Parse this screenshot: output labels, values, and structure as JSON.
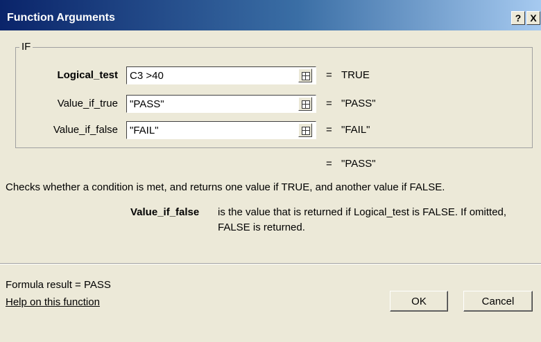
{
  "window": {
    "title": "Function Arguments",
    "help_glyph": "?",
    "close_glyph": "X"
  },
  "group": {
    "label": "IF"
  },
  "args": [
    {
      "label": "Logical_test",
      "value": "C3 >40",
      "equals": "=",
      "result": "TRUE"
    },
    {
      "label": "Value_if_true",
      "value": "\"PASS\"",
      "equals": "=",
      "result": "\"PASS\""
    },
    {
      "label": "Value_if_false",
      "value": "\"FAIL\"",
      "equals": "=",
      "result": "\"FAIL\""
    }
  ],
  "overall": {
    "equals": "=",
    "result": "\"PASS\""
  },
  "description": "Checks whether a condition is met, and returns one value if TRUE, and another value if FALSE.",
  "arg_help": {
    "name": "Value_if_false",
    "line1": "is the value that is returned if Logical_test is FALSE. If omitted,",
    "line2": "FALSE is returned."
  },
  "formula_result": "Formula result =   PASS",
  "help_link": "Help on this function",
  "buttons": {
    "ok": "OK",
    "cancel": "Cancel"
  },
  "icons": {
    "ref_button": "collapse-dialog-icon"
  }
}
